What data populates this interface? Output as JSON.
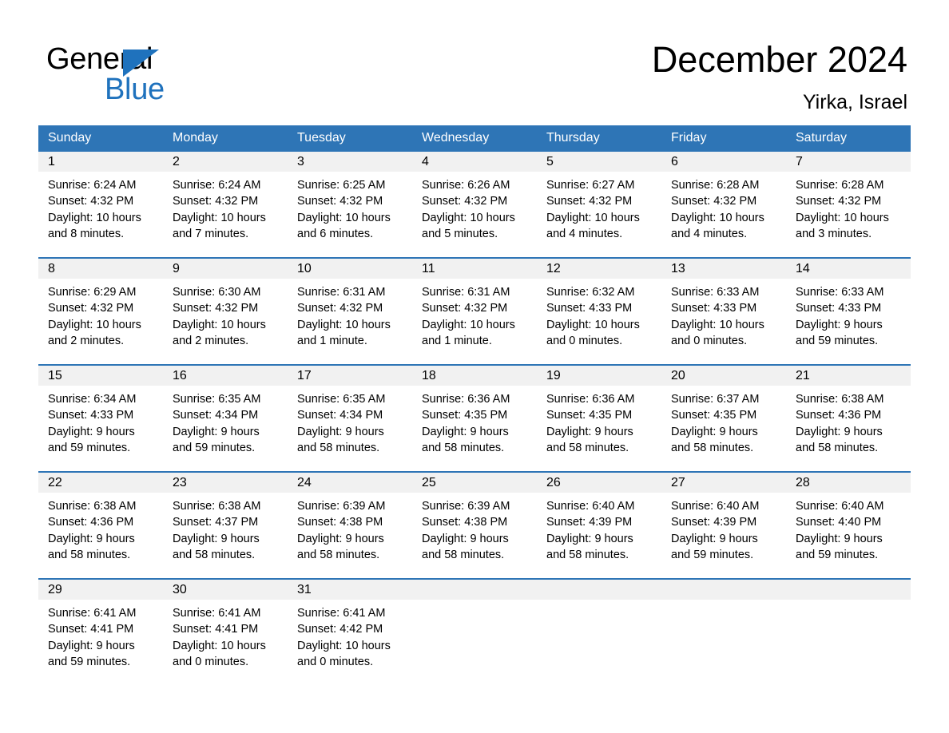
{
  "brand": {
    "name_dark": "General",
    "name_blue": "Blue",
    "accent_color": "#1F72BD"
  },
  "header": {
    "title": "December 2024",
    "location": "Yirka, Israel",
    "header_bg": "#2E75B6",
    "datecell_bg": "#F1F1F1"
  },
  "weekdays": [
    "Sunday",
    "Monday",
    "Tuesday",
    "Wednesday",
    "Thursday",
    "Friday",
    "Saturday"
  ],
  "weeks": [
    [
      {
        "day": "1",
        "sunrise": "Sunrise: 6:24 AM",
        "sunset": "Sunset: 4:32 PM",
        "daylight_1": "Daylight: 10 hours",
        "daylight_2": "and 8 minutes."
      },
      {
        "day": "2",
        "sunrise": "Sunrise: 6:24 AM",
        "sunset": "Sunset: 4:32 PM",
        "daylight_1": "Daylight: 10 hours",
        "daylight_2": "and 7 minutes."
      },
      {
        "day": "3",
        "sunrise": "Sunrise: 6:25 AM",
        "sunset": "Sunset: 4:32 PM",
        "daylight_1": "Daylight: 10 hours",
        "daylight_2": "and 6 minutes."
      },
      {
        "day": "4",
        "sunrise": "Sunrise: 6:26 AM",
        "sunset": "Sunset: 4:32 PM",
        "daylight_1": "Daylight: 10 hours",
        "daylight_2": "and 5 minutes."
      },
      {
        "day": "5",
        "sunrise": "Sunrise: 6:27 AM",
        "sunset": "Sunset: 4:32 PM",
        "daylight_1": "Daylight: 10 hours",
        "daylight_2": "and 4 minutes."
      },
      {
        "day": "6",
        "sunrise": "Sunrise: 6:28 AM",
        "sunset": "Sunset: 4:32 PM",
        "daylight_1": "Daylight: 10 hours",
        "daylight_2": "and 4 minutes."
      },
      {
        "day": "7",
        "sunrise": "Sunrise: 6:28 AM",
        "sunset": "Sunset: 4:32 PM",
        "daylight_1": "Daylight: 10 hours",
        "daylight_2": "and 3 minutes."
      }
    ],
    [
      {
        "day": "8",
        "sunrise": "Sunrise: 6:29 AM",
        "sunset": "Sunset: 4:32 PM",
        "daylight_1": "Daylight: 10 hours",
        "daylight_2": "and 2 minutes."
      },
      {
        "day": "9",
        "sunrise": "Sunrise: 6:30 AM",
        "sunset": "Sunset: 4:32 PM",
        "daylight_1": "Daylight: 10 hours",
        "daylight_2": "and 2 minutes."
      },
      {
        "day": "10",
        "sunrise": "Sunrise: 6:31 AM",
        "sunset": "Sunset: 4:32 PM",
        "daylight_1": "Daylight: 10 hours",
        "daylight_2": "and 1 minute."
      },
      {
        "day": "11",
        "sunrise": "Sunrise: 6:31 AM",
        "sunset": "Sunset: 4:32 PM",
        "daylight_1": "Daylight: 10 hours",
        "daylight_2": "and 1 minute."
      },
      {
        "day": "12",
        "sunrise": "Sunrise: 6:32 AM",
        "sunset": "Sunset: 4:33 PM",
        "daylight_1": "Daylight: 10 hours",
        "daylight_2": "and 0 minutes."
      },
      {
        "day": "13",
        "sunrise": "Sunrise: 6:33 AM",
        "sunset": "Sunset: 4:33 PM",
        "daylight_1": "Daylight: 10 hours",
        "daylight_2": "and 0 minutes."
      },
      {
        "day": "14",
        "sunrise": "Sunrise: 6:33 AM",
        "sunset": "Sunset: 4:33 PM",
        "daylight_1": "Daylight: 9 hours",
        "daylight_2": "and 59 minutes."
      }
    ],
    [
      {
        "day": "15",
        "sunrise": "Sunrise: 6:34 AM",
        "sunset": "Sunset: 4:33 PM",
        "daylight_1": "Daylight: 9 hours",
        "daylight_2": "and 59 minutes."
      },
      {
        "day": "16",
        "sunrise": "Sunrise: 6:35 AM",
        "sunset": "Sunset: 4:34 PM",
        "daylight_1": "Daylight: 9 hours",
        "daylight_2": "and 59 minutes."
      },
      {
        "day": "17",
        "sunrise": "Sunrise: 6:35 AM",
        "sunset": "Sunset: 4:34 PM",
        "daylight_1": "Daylight: 9 hours",
        "daylight_2": "and 58 minutes."
      },
      {
        "day": "18",
        "sunrise": "Sunrise: 6:36 AM",
        "sunset": "Sunset: 4:35 PM",
        "daylight_1": "Daylight: 9 hours",
        "daylight_2": "and 58 minutes."
      },
      {
        "day": "19",
        "sunrise": "Sunrise: 6:36 AM",
        "sunset": "Sunset: 4:35 PM",
        "daylight_1": "Daylight: 9 hours",
        "daylight_2": "and 58 minutes."
      },
      {
        "day": "20",
        "sunrise": "Sunrise: 6:37 AM",
        "sunset": "Sunset: 4:35 PM",
        "daylight_1": "Daylight: 9 hours",
        "daylight_2": "and 58 minutes."
      },
      {
        "day": "21",
        "sunrise": "Sunrise: 6:38 AM",
        "sunset": "Sunset: 4:36 PM",
        "daylight_1": "Daylight: 9 hours",
        "daylight_2": "and 58 minutes."
      }
    ],
    [
      {
        "day": "22",
        "sunrise": "Sunrise: 6:38 AM",
        "sunset": "Sunset: 4:36 PM",
        "daylight_1": "Daylight: 9 hours",
        "daylight_2": "and 58 minutes."
      },
      {
        "day": "23",
        "sunrise": "Sunrise: 6:38 AM",
        "sunset": "Sunset: 4:37 PM",
        "daylight_1": "Daylight: 9 hours",
        "daylight_2": "and 58 minutes."
      },
      {
        "day": "24",
        "sunrise": "Sunrise: 6:39 AM",
        "sunset": "Sunset: 4:38 PM",
        "daylight_1": "Daylight: 9 hours",
        "daylight_2": "and 58 minutes."
      },
      {
        "day": "25",
        "sunrise": "Sunrise: 6:39 AM",
        "sunset": "Sunset: 4:38 PM",
        "daylight_1": "Daylight: 9 hours",
        "daylight_2": "and 58 minutes."
      },
      {
        "day": "26",
        "sunrise": "Sunrise: 6:40 AM",
        "sunset": "Sunset: 4:39 PM",
        "daylight_1": "Daylight: 9 hours",
        "daylight_2": "and 58 minutes."
      },
      {
        "day": "27",
        "sunrise": "Sunrise: 6:40 AM",
        "sunset": "Sunset: 4:39 PM",
        "daylight_1": "Daylight: 9 hours",
        "daylight_2": "and 59 minutes."
      },
      {
        "day": "28",
        "sunrise": "Sunrise: 6:40 AM",
        "sunset": "Sunset: 4:40 PM",
        "daylight_1": "Daylight: 9 hours",
        "daylight_2": "and 59 minutes."
      }
    ],
    [
      {
        "day": "29",
        "sunrise": "Sunrise: 6:41 AM",
        "sunset": "Sunset: 4:41 PM",
        "daylight_1": "Daylight: 9 hours",
        "daylight_2": "and 59 minutes."
      },
      {
        "day": "30",
        "sunrise": "Sunrise: 6:41 AM",
        "sunset": "Sunset: 4:41 PM",
        "daylight_1": "Daylight: 10 hours",
        "daylight_2": "and 0 minutes."
      },
      {
        "day": "31",
        "sunrise": "Sunrise: 6:41 AM",
        "sunset": "Sunset: 4:42 PM",
        "daylight_1": "Daylight: 10 hours",
        "daylight_2": "and 0 minutes."
      },
      {
        "day": "",
        "sunrise": "",
        "sunset": "",
        "daylight_1": "",
        "daylight_2": ""
      },
      {
        "day": "",
        "sunrise": "",
        "sunset": "",
        "daylight_1": "",
        "daylight_2": ""
      },
      {
        "day": "",
        "sunrise": "",
        "sunset": "",
        "daylight_1": "",
        "daylight_2": ""
      },
      {
        "day": "",
        "sunrise": "",
        "sunset": "",
        "daylight_1": "",
        "daylight_2": ""
      }
    ]
  ]
}
